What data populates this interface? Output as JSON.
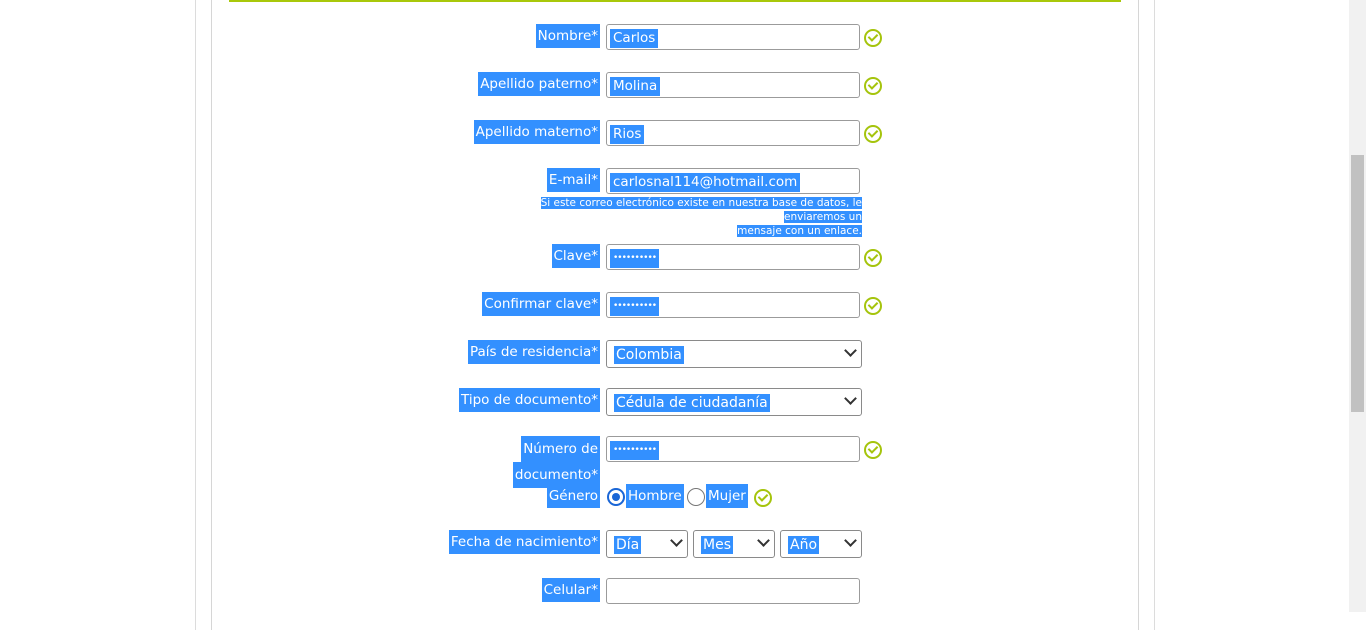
{
  "form": {
    "nombre": {
      "label": "Nombre*",
      "value": "Carlos"
    },
    "apellido_paterno": {
      "label": "Apellido paterno*",
      "value": "Molina"
    },
    "apellido_materno": {
      "label": "Apellido materno*",
      "value": "Rios"
    },
    "email": {
      "label": "E-mail*",
      "value": "carlosnal114@hotmail.com",
      "note_line1": "Si este correo electrónico existe en nuestra base de datos, le enviaremos un",
      "note_line2": "mensaje con un enlace."
    },
    "clave": {
      "label": "Clave*",
      "value": "••••••••••"
    },
    "confirmar_clave": {
      "label": "Confirmar clave*",
      "value": "••••••••••"
    },
    "pais": {
      "label": "País de residencia*",
      "value": "Colombia"
    },
    "tipo_documento": {
      "label": "Tipo de documento*",
      "value": "Cédula de ciudadanía"
    },
    "numero_documento": {
      "label_line1": "Número de",
      "label_line2": "documento*",
      "value": "••••••••••"
    },
    "genero": {
      "label": "Género",
      "option_hombre": "Hombre",
      "option_mujer": "Mujer",
      "selected": "Hombre"
    },
    "fecha_nacimiento": {
      "label": "Fecha de nacimiento*",
      "dia": "Día",
      "mes": "Mes",
      "anio": "Año"
    },
    "celular": {
      "label": "Celular*",
      "value": ""
    }
  },
  "colors": {
    "selection": "#3390ff",
    "accent": "#a9c80a",
    "radio": "#1a66d6"
  }
}
